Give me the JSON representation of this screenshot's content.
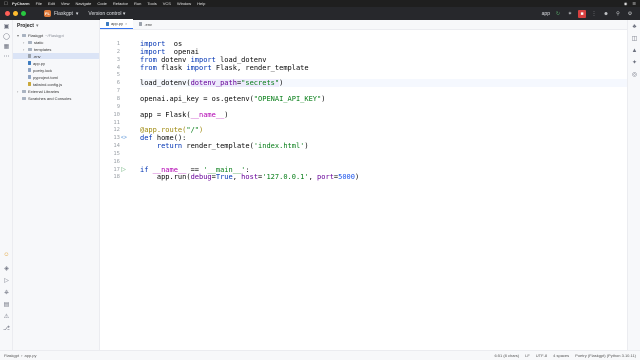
{
  "menubar": {
    "app": "PyCharm",
    "items": [
      "File",
      "Edit",
      "View",
      "Navigate",
      "Code",
      "Refactor",
      "Run",
      "Tools",
      "VCS",
      "Window",
      "Help"
    ]
  },
  "toolbar": {
    "project_badge": "FL",
    "project_name": "Flaskgpt",
    "vcs_label": "Version control",
    "run_config": "app"
  },
  "project_panel": {
    "title": "Project",
    "tree": [
      {
        "label": "Flaskgpt",
        "suffix": "~/Flaskgpt",
        "kind": "folder",
        "depth": 0,
        "chevron": "v"
      },
      {
        "label": "static",
        "kind": "folder",
        "depth": 1,
        "chevron": ">"
      },
      {
        "label": "templates",
        "kind": "folder",
        "depth": 1,
        "chevron": ">"
      },
      {
        "label": ".env",
        "kind": "env",
        "depth": 1,
        "chevron": "",
        "selected": true
      },
      {
        "label": "app.py",
        "kind": "py",
        "depth": 1,
        "chevron": ""
      },
      {
        "label": "poetry.lock",
        "kind": "file",
        "depth": 1,
        "chevron": ""
      },
      {
        "label": "pyproject.toml",
        "kind": "file",
        "depth": 1,
        "chevron": ""
      },
      {
        "label": "tailwind.config.js",
        "kind": "js",
        "depth": 1,
        "chevron": ""
      },
      {
        "label": "External Libraries",
        "kind": "folder",
        "depth": 0,
        "chevron": ">"
      },
      {
        "label": "Scratches and Consoles",
        "kind": "folder",
        "depth": 0,
        "chevron": ""
      }
    ]
  },
  "tabs": [
    {
      "label": "app.py",
      "active": true
    },
    {
      "label": ".env",
      "active": false
    }
  ],
  "editor": {
    "lines": [
      {
        "n": "1",
        "html": [
          [
            "kw",
            "import"
          ],
          [
            "",
            "  os"
          ]
        ]
      },
      {
        "n": "2",
        "html": [
          [
            "kw",
            "import"
          ],
          [
            "",
            "  openai"
          ]
        ]
      },
      {
        "n": "3",
        "html": [
          [
            "kw",
            "from"
          ],
          [
            "",
            " dotenv "
          ],
          [
            "kw",
            "import"
          ],
          [
            "",
            " load_dotenv"
          ]
        ]
      },
      {
        "n": "4",
        "html": [
          [
            "kw",
            "from"
          ],
          [
            "",
            " flask "
          ],
          [
            "kw",
            "import"
          ],
          [
            "",
            " Flask, render_template"
          ]
        ]
      },
      {
        "n": "5",
        "html": []
      },
      {
        "n": "6",
        "html": [
          [
            "",
            "load_dotenv("
          ],
          [
            "param hl",
            "dotenv_path"
          ],
          [
            "hl",
            "="
          ],
          [
            "str hl",
            "\"secrets\""
          ],
          [
            "",
            ")"
          ]
        ],
        "current": true
      },
      {
        "n": "7",
        "html": []
      },
      {
        "n": "8",
        "html": [
          [
            "",
            "openai.api_key = os.getenv("
          ],
          [
            "str",
            "\"OPENAI_API_KEY\""
          ],
          [
            "",
            ")"
          ]
        ]
      },
      {
        "n": "9",
        "html": []
      },
      {
        "n": "10",
        "html": [
          [
            "",
            "app = Flask("
          ],
          [
            "dunder",
            "__name__"
          ],
          [
            "",
            ")"
          ]
        ]
      },
      {
        "n": "11",
        "html": []
      },
      {
        "n": "12",
        "html": [
          [
            "deco",
            "@app.route("
          ],
          [
            "str",
            "\"/\""
          ],
          [
            "deco",
            ")"
          ]
        ]
      },
      {
        "n": "13",
        "html": [
          [
            "kw",
            "def"
          ],
          [
            "",
            " home():"
          ]
        ],
        "mark": "<>"
      },
      {
        "n": "14",
        "html": [
          [
            "",
            "    "
          ],
          [
            "kw",
            "return"
          ],
          [
            "",
            " render_template("
          ],
          [
            "str",
            "'index.html'"
          ],
          [
            "",
            ")"
          ]
        ]
      },
      {
        "n": "15",
        "html": []
      },
      {
        "n": "16",
        "html": []
      },
      {
        "n": "17",
        "html": [
          [
            "kw",
            "if"
          ],
          [
            "",
            " "
          ],
          [
            "dunder",
            "__name__"
          ],
          [
            "",
            " == "
          ],
          [
            "str",
            "'__main__'"
          ],
          [
            "",
            ":"
          ]
        ],
        "mark": "run"
      },
      {
        "n": "18",
        "html": [
          [
            "",
            "    app.run("
          ],
          [
            "param",
            "debug"
          ],
          [
            "",
            "="
          ],
          [
            "kw",
            "True"
          ],
          [
            "",
            ", "
          ],
          [
            "param",
            "host"
          ],
          [
            "",
            "="
          ],
          [
            "str",
            "'127.0.0.1'"
          ],
          [
            "",
            ", "
          ],
          [
            "param",
            "port"
          ],
          [
            "",
            "="
          ],
          [
            "num",
            "5000"
          ],
          [
            "",
            ")"
          ]
        ]
      }
    ]
  },
  "statusbar": {
    "crumbs": [
      "Flaskgpt",
      "app.py"
    ],
    "right": [
      "6:51 (8 chars)",
      "LF",
      "UTF-8",
      "4 spaces",
      "Poetry (Flaskgpt) (Python 3.10.11)"
    ]
  },
  "colors": {
    "keyword": "#0033b3",
    "string": "#067d17",
    "number": "#1750eb",
    "param": "#660099",
    "decorator": "#9e880d",
    "dunder": "#b200b2"
  }
}
